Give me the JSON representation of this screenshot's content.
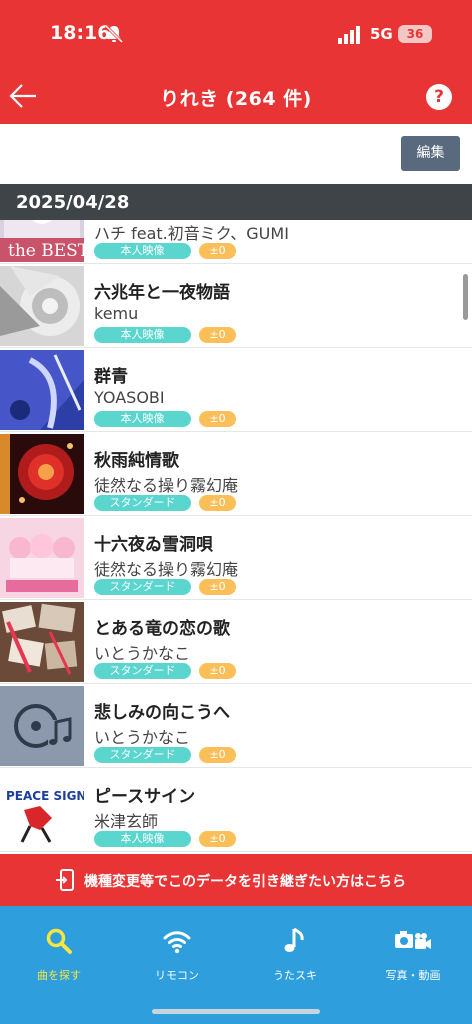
{
  "status_bar": {
    "time": "18:16",
    "network": "5G",
    "battery": "36"
  },
  "header": {
    "title": "りれき (264 件)",
    "help_label": "?"
  },
  "toolbar": {
    "edit_label": "編集"
  },
  "history": {
    "date": "2025/04/28",
    "items": [
      {
        "title": "",
        "artist": "ハチ feat.初音ミク、GUMI",
        "type": "本人映像",
        "score": "±0",
        "thumb_text": "the BEST"
      },
      {
        "title": "六兆年と一夜物語",
        "artist": "kemu",
        "type": "本人映像",
        "score": "±0"
      },
      {
        "title": "群青",
        "artist": "YOASOBI",
        "type": "本人映像",
        "score": "±0"
      },
      {
        "title": "秋雨純情歌",
        "artist": "徒然なる操り霧幻庵",
        "type": "スタンダード",
        "score": "±0"
      },
      {
        "title": "十六夜ゐ雪洞唄",
        "artist": "徒然なる操り霧幻庵",
        "type": "スタンダード",
        "score": "±0"
      },
      {
        "title": "とある竜の恋の歌",
        "artist": "いとうかなこ",
        "type": "スタンダード",
        "score": "±0"
      },
      {
        "title": "悲しみの向こうへ",
        "artist": "いとうかなこ",
        "type": "スタンダード",
        "score": "±0"
      },
      {
        "title": "ピースサイン",
        "artist": "米津玄師",
        "type": "本人映像",
        "score": "±0",
        "thumb_text": "PEACE SIGN"
      }
    ]
  },
  "banner": {
    "text": "機種変更等でこのデータを引き継ぎたい方はこちら"
  },
  "nav": {
    "items": [
      {
        "label": "曲を探す",
        "icon": "search-icon",
        "active": true
      },
      {
        "label": "リモコン",
        "icon": "wifi-icon",
        "active": false
      },
      {
        "label": "うたスキ",
        "icon": "music-note-icon",
        "active": false
      },
      {
        "label": "写真・動画",
        "icon": "camera-video-icon",
        "active": false
      }
    ]
  },
  "colors": {
    "brand_red": "#e83434",
    "nav_blue": "#2e9fdc",
    "active_yellow": "#f7e640",
    "badge_teal": "#5bd6cf",
    "badge_orange": "#fbbf5a",
    "date_bar": "#3e4448",
    "edit_button": "#5a6a7e"
  }
}
